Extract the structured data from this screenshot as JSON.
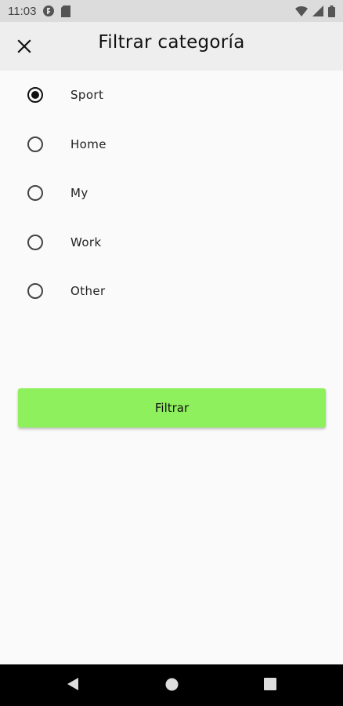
{
  "status_bar": {
    "time": "11:03",
    "icons": [
      "notification-app-icon",
      "sd-card-icon",
      "wifi-icon",
      "signal-icon",
      "battery-icon"
    ]
  },
  "app_bar": {
    "close_icon": "close-icon",
    "title": "Filtrar categoría"
  },
  "categories": {
    "selected": "Sport",
    "options": [
      {
        "label": "Sport",
        "checked": true
      },
      {
        "label": "Home",
        "checked": false
      },
      {
        "label": "My",
        "checked": false
      },
      {
        "label": "Work",
        "checked": false
      },
      {
        "label": "Other",
        "checked": false
      }
    ]
  },
  "filter_button": {
    "label": "Filtrar",
    "color": "#8ef05c"
  },
  "nav_bar": {
    "icons": [
      "back-icon",
      "home-icon",
      "recents-icon"
    ]
  }
}
